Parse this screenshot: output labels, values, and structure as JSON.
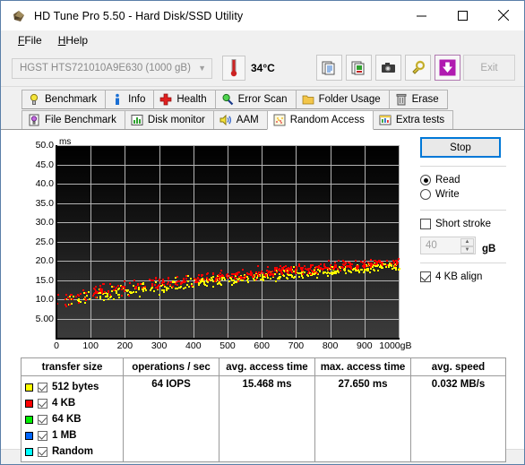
{
  "window": {
    "title": "HD Tune Pro 5.50 - Hard Disk/SSD Utility",
    "app_icon": "hdtune-diamond-icon",
    "minimize": "minimize-icon",
    "maximize": "maximize-icon",
    "close": "close-icon"
  },
  "menu": {
    "items": [
      {
        "label": "File",
        "mnemonic": "F"
      },
      {
        "label": "Help",
        "mnemonic": "H"
      }
    ]
  },
  "toolbar": {
    "drive": "HGST HTS721010A9E630 (1000 gB)",
    "drive_arrow": "chevron-down-icon",
    "temperature": "34°C",
    "thermometer_icon": "thermometer-icon",
    "buttons": [
      {
        "name": "copy-text-button",
        "icon": "copy-document-icon"
      },
      {
        "name": "copy-image-button",
        "icon": "copy-image-icon"
      },
      {
        "name": "screenshot-button",
        "icon": "camera-icon"
      },
      {
        "name": "options-button",
        "icon": "plug-icon"
      },
      {
        "name": "save-button",
        "icon": "download-arrow-icon"
      }
    ],
    "exit_label": "Exit"
  },
  "tabs": {
    "row1": [
      {
        "label": "Benchmark",
        "icon": "lightbulb-icon",
        "active": false
      },
      {
        "label": "Info",
        "icon": "info-icon",
        "active": false
      },
      {
        "label": "Health",
        "icon": "red-cross-icon",
        "active": false
      },
      {
        "label": "Error Scan",
        "icon": "magnifier-icon",
        "active": false
      },
      {
        "label": "Folder Usage",
        "icon": "folder-icon",
        "active": false
      },
      {
        "label": "Erase",
        "icon": "trash-icon",
        "active": false
      }
    ],
    "row2": [
      {
        "label": "File Benchmark",
        "icon": "file-bulb-icon",
        "active": false
      },
      {
        "label": "Disk monitor",
        "icon": "bar-chart-icon",
        "active": false
      },
      {
        "label": "AAM",
        "icon": "speaker-icon",
        "active": false
      },
      {
        "label": "Random Access",
        "icon": "scatter-icon",
        "active": true
      },
      {
        "label": "Extra tests",
        "icon": "extra-chart-icon",
        "active": false
      }
    ]
  },
  "controls": {
    "stop_label": "Stop",
    "mode_read": "Read",
    "mode_write": "Write",
    "mode_selected": "Read",
    "short_stroke_label": "Short stroke",
    "short_stroke_checked": false,
    "short_stroke_value": "40",
    "short_stroke_unit": "gB",
    "align_label": "4 KB align",
    "align_checked": true,
    "spin_up": "spin-up-icon",
    "spin_down": "spin-down-icon"
  },
  "results": {
    "headers": [
      "transfer size",
      "operations / sec",
      "avg. access time",
      "max. access time",
      "avg. speed"
    ],
    "legend": [
      {
        "label": "512 bytes",
        "color": "#ffff00",
        "checked": true
      },
      {
        "label": "4 KB",
        "color": "#ff0000",
        "checked": true
      },
      {
        "label": "64 KB",
        "color": "#00ee00",
        "checked": true
      },
      {
        "label": "1 MB",
        "color": "#0066ff",
        "checked": true
      },
      {
        "label": "Random",
        "color": "#00ffff",
        "checked": true
      }
    ],
    "values": {
      "operations_per_sec": "64 IOPS",
      "avg_access_time": "15.468 ms",
      "max_access_time": "27.650 ms",
      "avg_speed": "0.032 MB/s"
    }
  },
  "chart_data": {
    "type": "scatter",
    "title": "",
    "xlabel": "",
    "ylabel": "ms",
    "y_unit": "ms",
    "x_unit": "gB",
    "xlim": [
      0,
      1000
    ],
    "ylim": [
      0,
      50
    ],
    "yticks": [
      "5.00",
      "10.0",
      "15.0",
      "20.0",
      "25.0",
      "30.0",
      "35.0",
      "40.0",
      "45.0",
      "50.0"
    ],
    "ytick_values": [
      5,
      10,
      15,
      20,
      25,
      30,
      35,
      40,
      45,
      50
    ],
    "xticks": [
      "0",
      "100",
      "200",
      "300",
      "400",
      "500",
      "600",
      "700",
      "800",
      "900",
      "1000gB"
    ],
    "xtick_values": [
      0,
      100,
      200,
      300,
      400,
      500,
      600,
      700,
      800,
      900,
      1000
    ],
    "grid": true,
    "background": "#000000-to-#3b3b3b vertical gradient",
    "series": [
      {
        "name": "512 bytes",
        "color": "#ffff00",
        "description": "Access time rises from ~8 ms near offset 0 to ~19 ms near 1000 gB, scattered band width ~6 ms",
        "trend_start_ms": 8.5,
        "trend_end_ms": 19.0,
        "spread_ms": 6.0,
        "n_points": 420
      },
      {
        "name": "4 KB",
        "color": "#ff0000",
        "description": "Access time rises from ~9 ms near offset 0 to ~20 ms near 1000 gB, scattered band width ~6 ms",
        "trend_start_ms": 9.5,
        "trend_end_ms": 20.0,
        "spread_ms": 6.0,
        "n_points": 420
      }
    ],
    "summary": {
      "operations_per_sec": 64,
      "avg_access_time_ms": 15.468,
      "max_access_time_ms": 27.65,
      "avg_speed_mb_s": 0.032
    }
  }
}
